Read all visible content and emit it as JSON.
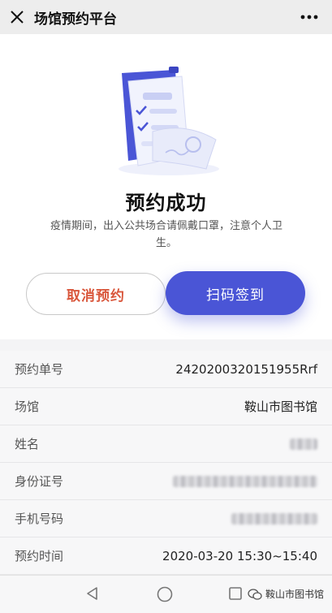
{
  "header": {
    "title": "场馆预约平台",
    "close_icon": "close-icon",
    "more_icon": "more-dots-icon"
  },
  "success": {
    "title": "预约成功",
    "description": "疫情期间，出入公共场合请佩戴口罩，注意个人卫生。",
    "cancel_label": "取消预约",
    "scan_label": "扫码签到",
    "illustration_icon": "document-checklist-icon"
  },
  "details": {
    "rows": [
      {
        "label": "预约单号",
        "value": "2420200320151955Rrf"
      },
      {
        "label": "场馆",
        "value": "鞍山市图书馆"
      },
      {
        "label": "姓名",
        "value": ""
      },
      {
        "label": "身份证号",
        "value": ""
      },
      {
        "label": "手机号码",
        "value": ""
      },
      {
        "label": "预约时间",
        "value": "2020-03-20 15:30~15:40"
      }
    ]
  },
  "nav": {
    "back_icon": "back-triangle-icon",
    "home_icon": "home-circle-icon",
    "recent_icon": "recent-square-icon",
    "watermark_text": "鞍山市图书馆"
  },
  "colors": {
    "accent": "#4a55d6",
    "cancel_text": "#d9573c"
  }
}
